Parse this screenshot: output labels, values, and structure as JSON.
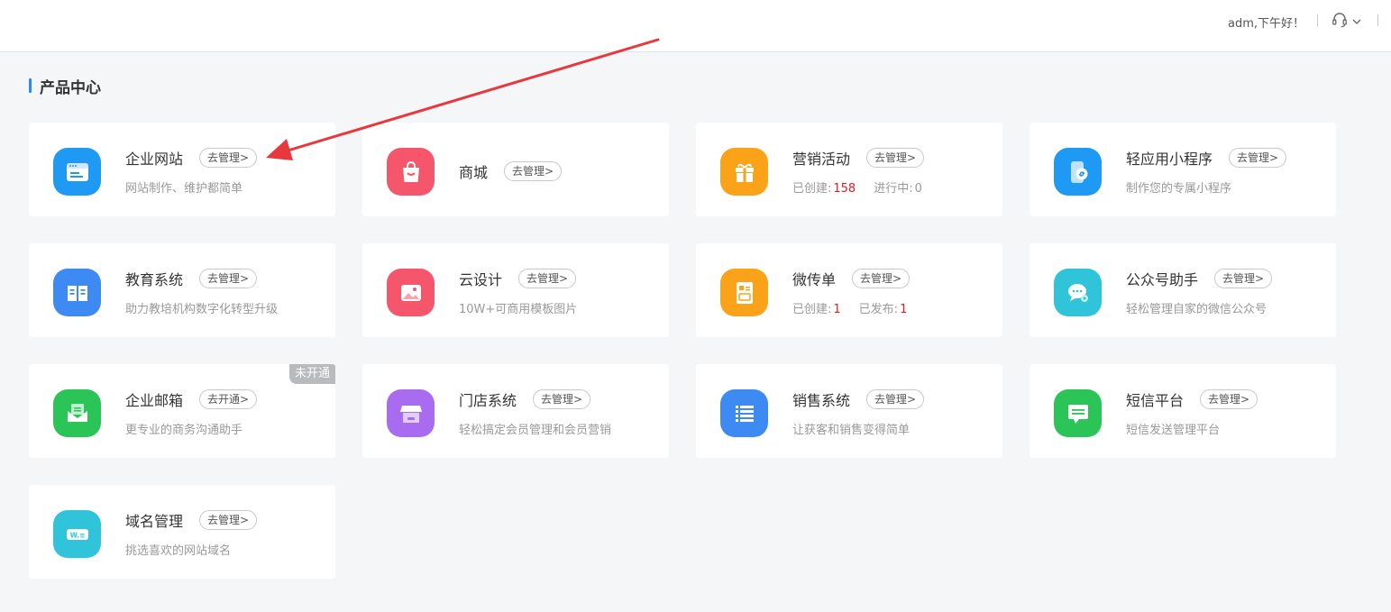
{
  "header": {
    "greeting": "adm,下午好！",
    "support_icon": "headset-icon",
    "dropdown_icon": "chevron-down-icon"
  },
  "section": {
    "title": "产品中心",
    "accent": "#2b8bf0"
  },
  "products": [
    {
      "name": "企业网站",
      "action": "去管理>",
      "desc": "网站制作、维护都简单",
      "icon": "browser-window-icon",
      "color": "#1e9af5"
    },
    {
      "name": "商城",
      "action": "去管理>",
      "icon": "shopping-bag-icon",
      "color": "#f5566c"
    },
    {
      "name": "营销活动",
      "action": "去管理>",
      "icon": "gift-icon",
      "color": "#fba318",
      "stats": [
        {
          "label": "已创建:",
          "value": "158"
        },
        {
          "label": "进行中:",
          "value": "0"
        }
      ]
    },
    {
      "name": "轻应用小程序",
      "action": "去管理>",
      "desc": "制作您的专属小程序",
      "icon": "mini-program-phone-icon",
      "color": "#1e9af5"
    },
    {
      "name": "教育系统",
      "action": "去管理>",
      "desc": "助力教培机构数字化转型升级",
      "icon": "open-book-icon",
      "color": "#3d8bf2"
    },
    {
      "name": "云设计",
      "action": "去管理>",
      "desc": "10W+可商用模板图片",
      "icon": "image-icon",
      "color": "#f5566c"
    },
    {
      "name": "微传单",
      "action": "去管理>",
      "icon": "flyer-icon",
      "color": "#fba318",
      "stats": [
        {
          "label": "已创建:",
          "value": "1"
        },
        {
          "label": "已发布:",
          "value": "1"
        }
      ]
    },
    {
      "name": "公众号助手",
      "action": "去管理>",
      "desc": "轻松管理自家的微信公众号",
      "icon": "wechat-chat-icon",
      "color": "#2fc4d9"
    },
    {
      "name": "企业邮箱",
      "action": "去开通>",
      "desc": "更专业的商务沟通助手",
      "icon": "mail-icon",
      "color": "#2bc457",
      "badge": "未开通"
    },
    {
      "name": "门店系统",
      "action": "去管理>",
      "desc": "轻松搞定会员管理和会员营销",
      "icon": "storefront-icon",
      "color": "#a96cf0"
    },
    {
      "name": "销售系统",
      "action": "去管理>",
      "desc": "让获客和销售变得简单",
      "icon": "list-icon",
      "color": "#3d8bf2"
    },
    {
      "name": "短信平台",
      "action": "去管理>",
      "desc": "短信发送管理平台",
      "icon": "sms-icon",
      "color": "#2bc457"
    },
    {
      "name": "域名管理",
      "action": "去管理>",
      "desc": "挑选喜欢的网站域名",
      "icon": "domain-tag-icon",
      "color": "#2fc4d9",
      "icon_text": "W.≡"
    }
  ],
  "colors": {
    "stat_value": "#e02020",
    "arrow": "#e8383d"
  }
}
